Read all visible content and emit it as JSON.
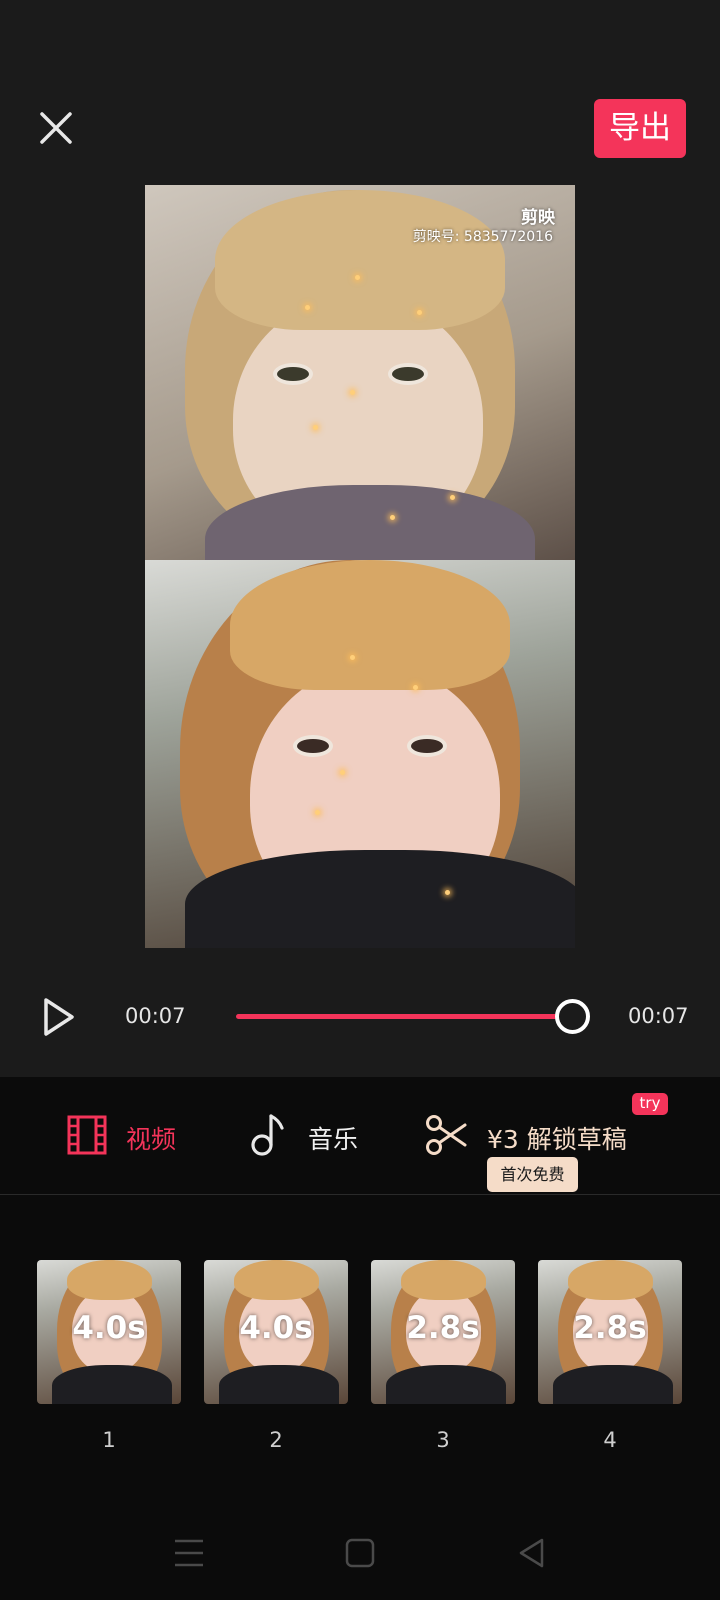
{
  "header": {
    "close_icon": "close-icon",
    "export_label": "导出",
    "accent_color": "#f4345a"
  },
  "preview": {
    "watermark_logo": "剪映",
    "watermark_id": "剪映号: 5835772016"
  },
  "playback": {
    "current_time": "00:07",
    "total_time": "00:07",
    "progress": 1.0
  },
  "tabs": [
    {
      "label": "视频",
      "icon": "film-icon",
      "active": true
    },
    {
      "label": "音乐",
      "icon": "music-note-icon",
      "active": false
    },
    {
      "label": "¥3 解锁草稿",
      "icon": "scissors-icon",
      "active": false
    }
  ],
  "badges": {
    "try_label": "try",
    "free_label": "首次免费"
  },
  "clips": [
    {
      "duration": "4.0s",
      "index": "1"
    },
    {
      "duration": "4.0s",
      "index": "2"
    },
    {
      "duration": "2.8s",
      "index": "3"
    },
    {
      "duration": "2.8s",
      "index": "4"
    }
  ],
  "nav_bar": [
    "menu-icon",
    "home-icon",
    "back-icon"
  ]
}
